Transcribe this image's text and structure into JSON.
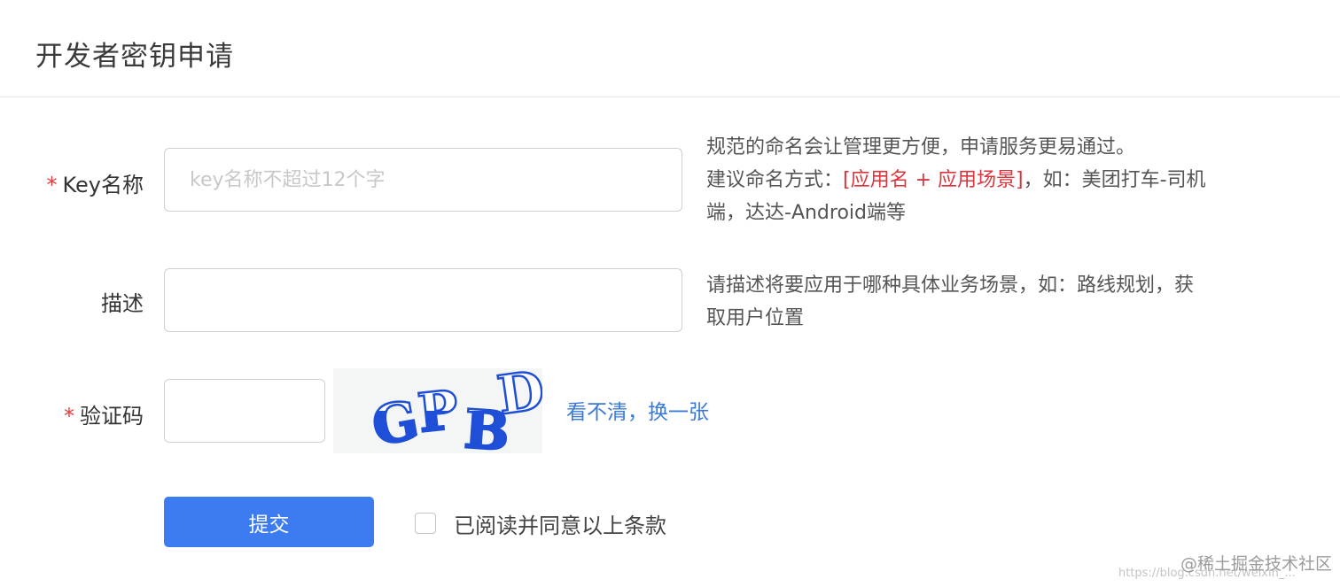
{
  "header": {
    "title": "开发者密钥申请"
  },
  "form": {
    "key_name": {
      "required_mark": "*",
      "label": "Key名称",
      "placeholder": "key名称不超过12个字",
      "value": "",
      "hint_line1": "规范的命名会让管理更方便，申请服务更易通过。",
      "hint_line2_prefix": "建议命名方式：",
      "hint_line2_emphasis": "[应用名 + 应用场景]",
      "hint_line2_suffix": "，如：美团打车-司机",
      "hint_line3": "端，达达-Android端等"
    },
    "description": {
      "label": "描述",
      "value": "",
      "hint_line1": "请描述将要应用于哪种具体业务场景，如：路线规划，获",
      "hint_line2": "取用户位置"
    },
    "captcha": {
      "required_mark": "*",
      "label": "验证码",
      "value": "",
      "image_text": "GPBD",
      "refresh_link": "看不清，换一张"
    },
    "submit_label": "提交",
    "agreement": {
      "checked": false,
      "label": "已阅读并同意以上条款"
    }
  },
  "watermark": {
    "text": "@稀土掘金技术社区",
    "url": "https://blog.csdn.net/weixin_..."
  },
  "colors": {
    "primary": "#3d7bf0",
    "link": "#3b7ad9",
    "required": "#e4393c",
    "emphasis": "#d9363e",
    "captcha_blue": "#1f4fd6"
  }
}
